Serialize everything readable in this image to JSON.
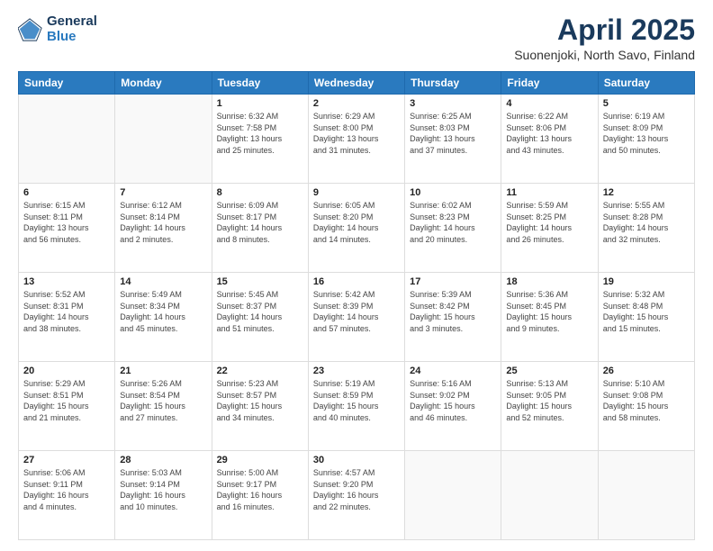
{
  "header": {
    "logo_general": "General",
    "logo_blue": "Blue",
    "month_title": "April 2025",
    "location": "Suonenjoki, North Savo, Finland"
  },
  "weekdays": [
    "Sunday",
    "Monday",
    "Tuesday",
    "Wednesday",
    "Thursday",
    "Friday",
    "Saturday"
  ],
  "weeks": [
    [
      {
        "day": "",
        "info": ""
      },
      {
        "day": "",
        "info": ""
      },
      {
        "day": "1",
        "info": "Sunrise: 6:32 AM\nSunset: 7:58 PM\nDaylight: 13 hours\nand 25 minutes."
      },
      {
        "day": "2",
        "info": "Sunrise: 6:29 AM\nSunset: 8:00 PM\nDaylight: 13 hours\nand 31 minutes."
      },
      {
        "day": "3",
        "info": "Sunrise: 6:25 AM\nSunset: 8:03 PM\nDaylight: 13 hours\nand 37 minutes."
      },
      {
        "day": "4",
        "info": "Sunrise: 6:22 AM\nSunset: 8:06 PM\nDaylight: 13 hours\nand 43 minutes."
      },
      {
        "day": "5",
        "info": "Sunrise: 6:19 AM\nSunset: 8:09 PM\nDaylight: 13 hours\nand 50 minutes."
      }
    ],
    [
      {
        "day": "6",
        "info": "Sunrise: 6:15 AM\nSunset: 8:11 PM\nDaylight: 13 hours\nand 56 minutes."
      },
      {
        "day": "7",
        "info": "Sunrise: 6:12 AM\nSunset: 8:14 PM\nDaylight: 14 hours\nand 2 minutes."
      },
      {
        "day": "8",
        "info": "Sunrise: 6:09 AM\nSunset: 8:17 PM\nDaylight: 14 hours\nand 8 minutes."
      },
      {
        "day": "9",
        "info": "Sunrise: 6:05 AM\nSunset: 8:20 PM\nDaylight: 14 hours\nand 14 minutes."
      },
      {
        "day": "10",
        "info": "Sunrise: 6:02 AM\nSunset: 8:23 PM\nDaylight: 14 hours\nand 20 minutes."
      },
      {
        "day": "11",
        "info": "Sunrise: 5:59 AM\nSunset: 8:25 PM\nDaylight: 14 hours\nand 26 minutes."
      },
      {
        "day": "12",
        "info": "Sunrise: 5:55 AM\nSunset: 8:28 PM\nDaylight: 14 hours\nand 32 minutes."
      }
    ],
    [
      {
        "day": "13",
        "info": "Sunrise: 5:52 AM\nSunset: 8:31 PM\nDaylight: 14 hours\nand 38 minutes."
      },
      {
        "day": "14",
        "info": "Sunrise: 5:49 AM\nSunset: 8:34 PM\nDaylight: 14 hours\nand 45 minutes."
      },
      {
        "day": "15",
        "info": "Sunrise: 5:45 AM\nSunset: 8:37 PM\nDaylight: 14 hours\nand 51 minutes."
      },
      {
        "day": "16",
        "info": "Sunrise: 5:42 AM\nSunset: 8:39 PM\nDaylight: 14 hours\nand 57 minutes."
      },
      {
        "day": "17",
        "info": "Sunrise: 5:39 AM\nSunset: 8:42 PM\nDaylight: 15 hours\nand 3 minutes."
      },
      {
        "day": "18",
        "info": "Sunrise: 5:36 AM\nSunset: 8:45 PM\nDaylight: 15 hours\nand 9 minutes."
      },
      {
        "day": "19",
        "info": "Sunrise: 5:32 AM\nSunset: 8:48 PM\nDaylight: 15 hours\nand 15 minutes."
      }
    ],
    [
      {
        "day": "20",
        "info": "Sunrise: 5:29 AM\nSunset: 8:51 PM\nDaylight: 15 hours\nand 21 minutes."
      },
      {
        "day": "21",
        "info": "Sunrise: 5:26 AM\nSunset: 8:54 PM\nDaylight: 15 hours\nand 27 minutes."
      },
      {
        "day": "22",
        "info": "Sunrise: 5:23 AM\nSunset: 8:57 PM\nDaylight: 15 hours\nand 34 minutes."
      },
      {
        "day": "23",
        "info": "Sunrise: 5:19 AM\nSunset: 8:59 PM\nDaylight: 15 hours\nand 40 minutes."
      },
      {
        "day": "24",
        "info": "Sunrise: 5:16 AM\nSunset: 9:02 PM\nDaylight: 15 hours\nand 46 minutes."
      },
      {
        "day": "25",
        "info": "Sunrise: 5:13 AM\nSunset: 9:05 PM\nDaylight: 15 hours\nand 52 minutes."
      },
      {
        "day": "26",
        "info": "Sunrise: 5:10 AM\nSunset: 9:08 PM\nDaylight: 15 hours\nand 58 minutes."
      }
    ],
    [
      {
        "day": "27",
        "info": "Sunrise: 5:06 AM\nSunset: 9:11 PM\nDaylight: 16 hours\nand 4 minutes."
      },
      {
        "day": "28",
        "info": "Sunrise: 5:03 AM\nSunset: 9:14 PM\nDaylight: 16 hours\nand 10 minutes."
      },
      {
        "day": "29",
        "info": "Sunrise: 5:00 AM\nSunset: 9:17 PM\nDaylight: 16 hours\nand 16 minutes."
      },
      {
        "day": "30",
        "info": "Sunrise: 4:57 AM\nSunset: 9:20 PM\nDaylight: 16 hours\nand 22 minutes."
      },
      {
        "day": "",
        "info": ""
      },
      {
        "day": "",
        "info": ""
      },
      {
        "day": "",
        "info": ""
      }
    ]
  ]
}
